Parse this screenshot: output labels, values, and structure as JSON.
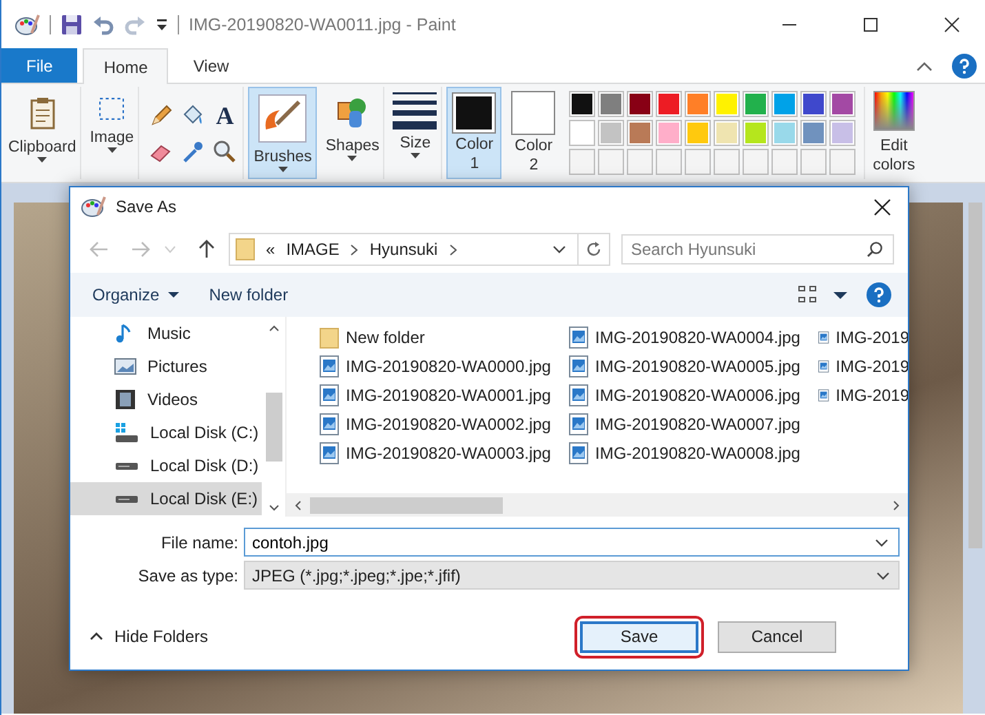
{
  "window": {
    "title": "IMG-20190820-WA0011.jpg - Paint"
  },
  "ribbon_tabs": [
    {
      "label": "File",
      "kind": "file",
      "selected": false
    },
    {
      "label": "Home",
      "kind": "tab",
      "selected": true
    },
    {
      "label": "View",
      "kind": "tab",
      "selected": false
    }
  ],
  "ribbon": {
    "clipboard": {
      "label": "Clipboard"
    },
    "image": {
      "label": "Image"
    },
    "tools": [
      {
        "kind": "pencil"
      },
      {
        "kind": "fill"
      },
      {
        "kind": "text",
        "glyph": "A"
      },
      {
        "kind": "eraser"
      },
      {
        "kind": "picker"
      },
      {
        "kind": "magnifier"
      }
    ],
    "brushes": {
      "label": "Brushes",
      "selected": true
    },
    "shapes": {
      "label": "Shapes"
    },
    "size": {
      "label": "Size"
    },
    "colors": [
      {
        "label": "Color 1",
        "color": "#111111",
        "selected": true
      },
      {
        "label": "Color 2",
        "color": "#ffffff",
        "selected": false
      }
    ],
    "palette": [
      {
        "kind": "swatch",
        "color": "#111111"
      },
      {
        "kind": "swatch",
        "color": "#7f7f7f"
      },
      {
        "kind": "swatch",
        "color": "#880015"
      },
      {
        "kind": "swatch",
        "color": "#ed1c24"
      },
      {
        "kind": "swatch",
        "color": "#ff7f27"
      },
      {
        "kind": "swatch",
        "color": "#fff200"
      },
      {
        "kind": "swatch",
        "color": "#22b14c"
      },
      {
        "kind": "swatch",
        "color": "#00a2e8"
      },
      {
        "kind": "swatch",
        "color": "#3f48cc"
      },
      {
        "kind": "swatch",
        "color": "#a349a4"
      },
      {
        "kind": "swatch",
        "color": "#ffffff"
      },
      {
        "kind": "swatch",
        "color": "#c3c3c3"
      },
      {
        "kind": "swatch",
        "color": "#b97a57"
      },
      {
        "kind": "swatch",
        "color": "#ffaec9"
      },
      {
        "kind": "swatch",
        "color": "#ffc90e"
      },
      {
        "kind": "swatch",
        "color": "#efe4b0"
      },
      {
        "kind": "swatch",
        "color": "#b5e61d"
      },
      {
        "kind": "swatch",
        "color": "#99d9ea"
      },
      {
        "kind": "swatch",
        "color": "#7092be"
      },
      {
        "kind": "swatch",
        "color": "#c8bfe7"
      },
      {
        "kind": "empty"
      },
      {
        "kind": "empty"
      },
      {
        "kind": "empty"
      },
      {
        "kind": "empty"
      },
      {
        "kind": "empty"
      },
      {
        "kind": "empty"
      },
      {
        "kind": "empty"
      },
      {
        "kind": "empty"
      },
      {
        "kind": "empty"
      },
      {
        "kind": "empty"
      }
    ],
    "edit_colors": {
      "label": "Edit colors"
    }
  },
  "dialog": {
    "title": "Save As",
    "address": {
      "overflow": "«",
      "path": [
        {
          "label": "IMAGE"
        },
        {
          "label": "Hyunsuki"
        }
      ]
    },
    "search": {
      "placeholder": "Search Hyunsuki"
    },
    "toolbar": [
      {
        "label": "Organize",
        "dropdown": true
      },
      {
        "label": "New folder",
        "dropdown": false
      }
    ],
    "sidebar": [
      {
        "label": "Music",
        "kind": "music",
        "selected": false
      },
      {
        "label": "Pictures",
        "kind": "pictures",
        "selected": false
      },
      {
        "label": "Videos",
        "kind": "videos",
        "selected": false
      },
      {
        "label": "Local Disk (C:)",
        "kind": "system-disk",
        "selected": false
      },
      {
        "label": "Local Disk (D:)",
        "kind": "disk",
        "selected": false
      },
      {
        "label": "Local Disk (E:)",
        "kind": "disk",
        "selected": true
      }
    ],
    "files": [
      {
        "name": "New folder",
        "kind": "folder"
      },
      {
        "name": "IMG-20190820-WA0000.jpg",
        "kind": "image"
      },
      {
        "name": "IMG-20190820-WA0001.jpg",
        "kind": "image"
      },
      {
        "name": "IMG-20190820-WA0002.jpg",
        "kind": "image"
      },
      {
        "name": "IMG-20190820-WA0003.jpg",
        "kind": "image"
      },
      {
        "name": "IMG-20190820-WA0004.jpg",
        "kind": "image"
      },
      {
        "name": "IMG-20190820-WA0005.jpg",
        "kind": "image"
      },
      {
        "name": "IMG-20190820-WA0006.jpg",
        "kind": "image"
      },
      {
        "name": "IMG-20190820-WA0007.jpg",
        "kind": "image"
      },
      {
        "name": "IMG-20190820-WA0008.jpg",
        "kind": "image"
      },
      {
        "name": "IMG-2019",
        "kind": "image"
      },
      {
        "name": "IMG-2019",
        "kind": "image"
      },
      {
        "name": "IMG-2019",
        "kind": "image"
      }
    ],
    "file_name": {
      "label": "File name:",
      "value": "contoh.jpg"
    },
    "save_type": {
      "label": "Save as type:",
      "value": "JPEG (*.jpg;*.jpeg;*.jpe;*.jfif)"
    },
    "hide_folders": {
      "label": "Hide Folders"
    },
    "buttons": [
      {
        "label": "Save",
        "kind": "primary",
        "highlighted": true
      },
      {
        "label": "Cancel",
        "kind": "secondary",
        "highlighted": false
      }
    ]
  }
}
